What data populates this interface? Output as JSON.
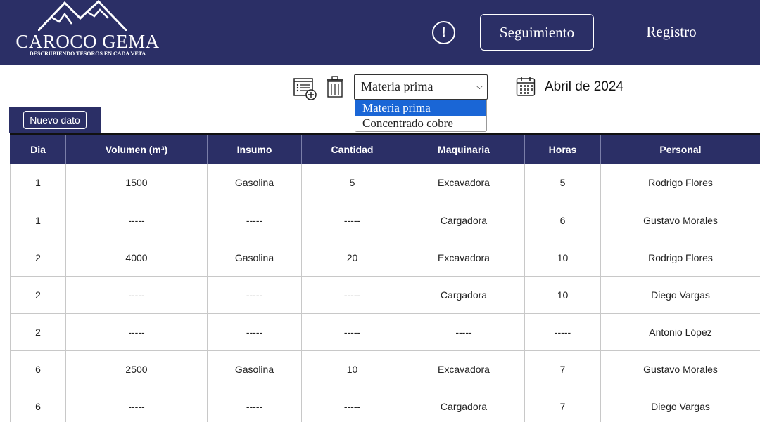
{
  "brand": {
    "name": "CAROCO GEMA",
    "tagline": "DESCRUBIENDO TESOROS EN CADA VETA"
  },
  "nav": {
    "alert_label": "!",
    "seguimiento": "Seguimiento",
    "registro": "Registro"
  },
  "toolbar": {
    "select_value": "Materia prima",
    "select_options": [
      "Materia prima",
      "Concentrado cobre"
    ],
    "date_label": "Abril de 2024"
  },
  "tab": {
    "nuevo_dato": "Nuevo dato"
  },
  "table": {
    "headers": [
      "Dia",
      "Volumen (m³)",
      "Insumo",
      "Cantidad",
      "Maquinaria",
      "Horas",
      "Personal"
    ],
    "rows": [
      [
        "1",
        "1500",
        "Gasolina",
        "5",
        "Excavadora",
        "5",
        "Rodrigo Flores"
      ],
      [
        "1",
        "-----",
        "-----",
        "-----",
        "Cargadora",
        "6",
        "Gustavo Morales"
      ],
      [
        "2",
        "4000",
        "Gasolina",
        "20",
        "Excavadora",
        "10",
        "Rodrigo Flores"
      ],
      [
        "2",
        "-----",
        "-----",
        "-----",
        "Cargadora",
        "10",
        "Diego Vargas"
      ],
      [
        "2",
        "-----",
        "-----",
        "-----",
        "-----",
        "-----",
        "Antonio López"
      ],
      [
        "6",
        "2500",
        "Gasolina",
        "10",
        "Excavadora",
        "7",
        "Gustavo Morales"
      ],
      [
        "6",
        "-----",
        "-----",
        "-----",
        "Cargadora",
        "7",
        "Diego Vargas"
      ]
    ]
  },
  "colors": {
    "header_bg": "#2b2f66",
    "selected_option": "#1a66d6"
  },
  "icons": [
    "mountain-logo-icon",
    "alert-icon",
    "add-list-icon",
    "trash-icon",
    "calendar-icon",
    "chevron-down-icon"
  ]
}
